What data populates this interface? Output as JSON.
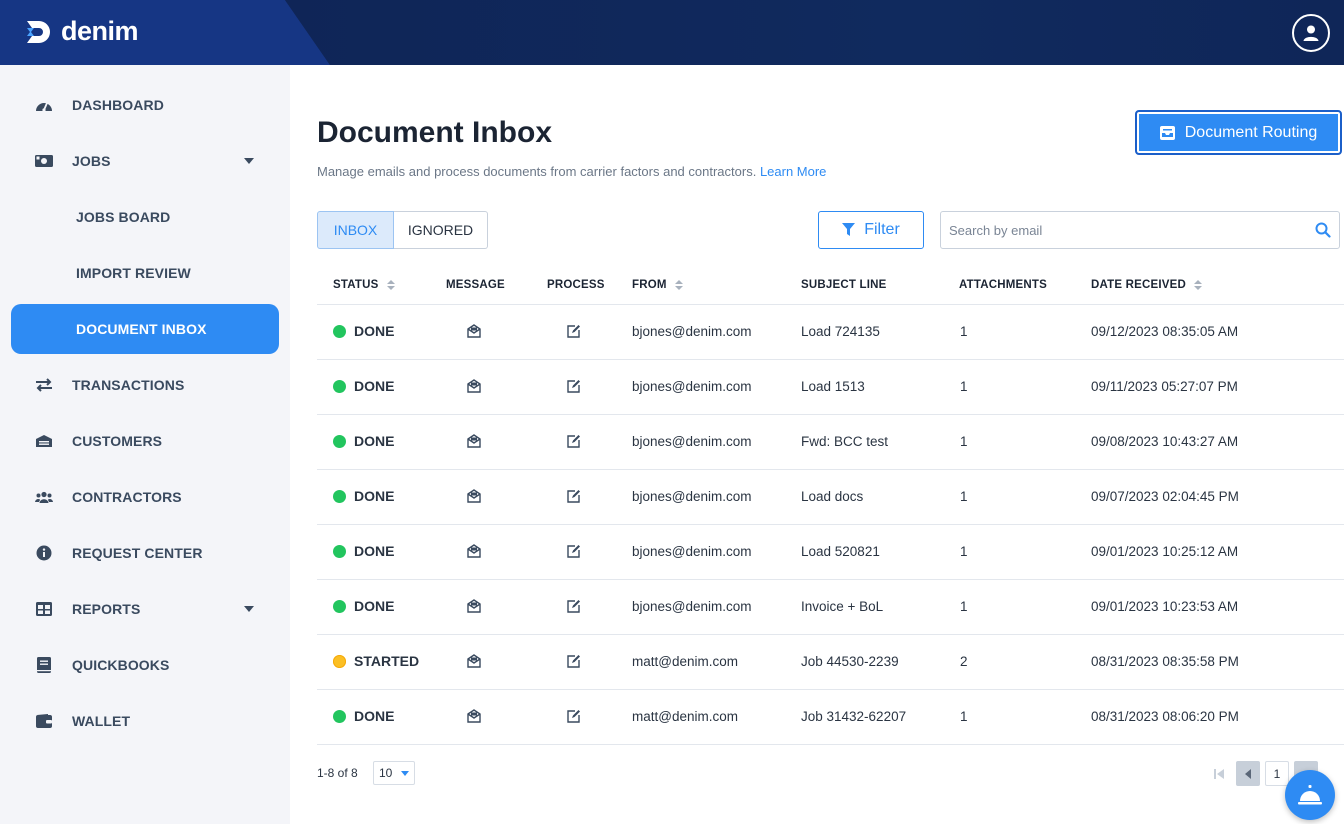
{
  "brand": {
    "name": "denim"
  },
  "sidebar": {
    "items": [
      {
        "label": "DASHBOARD",
        "icon": "dashboard-icon"
      },
      {
        "label": "JOBS",
        "icon": "jobs-icon",
        "expandable": true
      },
      {
        "label": "JOBS BOARD",
        "sub": true
      },
      {
        "label": "IMPORT REVIEW",
        "sub": true
      },
      {
        "label": "DOCUMENT INBOX",
        "sub": true,
        "active": true
      },
      {
        "label": "TRANSACTIONS",
        "icon": "transfer-icon"
      },
      {
        "label": "CUSTOMERS",
        "icon": "building-icon"
      },
      {
        "label": "CONTRACTORS",
        "icon": "users-icon"
      },
      {
        "label": "REQUEST CENTER",
        "icon": "info-icon"
      },
      {
        "label": "REPORTS",
        "icon": "table-icon",
        "expandable": true
      },
      {
        "label": "QUICKBOOKS",
        "icon": "book-icon"
      },
      {
        "label": "WALLET",
        "icon": "wallet-icon"
      }
    ]
  },
  "main": {
    "title": "Document Inbox",
    "subtitle": "Manage emails and process documents from carrier factors and contractors.",
    "learn_more": "Learn More",
    "routing_button": "Document Routing",
    "tabs": {
      "inbox": "INBOX",
      "ignored": "IGNORED"
    },
    "filter_label": "Filter",
    "search": {
      "placeholder": "Search by email",
      "value": ""
    }
  },
  "table": {
    "headers": {
      "status": "STATUS",
      "message": "MESSAGE",
      "process": "PROCESS",
      "from": "FROM",
      "subject": "SUBJECT LINE",
      "attachments": "ATTACHMENTS",
      "date": "DATE RECEIVED"
    },
    "rows": [
      {
        "status": "DONE",
        "from": "bjones@denim.com",
        "subject": "Load 724135",
        "attachments": "1",
        "date": "09/12/2023 08:35:05 AM"
      },
      {
        "status": "DONE",
        "from": "bjones@denim.com",
        "subject": "Load 1513",
        "attachments": "1",
        "date": "09/11/2023 05:27:07 PM"
      },
      {
        "status": "DONE",
        "from": "bjones@denim.com",
        "subject": "Fwd: BCC test",
        "attachments": "1",
        "date": "09/08/2023 10:43:27 AM"
      },
      {
        "status": "DONE",
        "from": "bjones@denim.com",
        "subject": "Load docs",
        "attachments": "1",
        "date": "09/07/2023 02:04:45 PM"
      },
      {
        "status": "DONE",
        "from": "bjones@denim.com",
        "subject": "Load 520821",
        "attachments": "1",
        "date": "09/01/2023 10:25:12 AM"
      },
      {
        "status": "DONE",
        "from": "bjones@denim.com",
        "subject": "Invoice + BoL",
        "attachments": "1",
        "date": "09/01/2023 10:23:53 AM"
      },
      {
        "status": "STARTED",
        "from": "matt@denim.com",
        "subject": "Job 44530-2239",
        "attachments": "2",
        "date": "08/31/2023 08:35:58 PM"
      },
      {
        "status": "DONE",
        "from": "matt@denim.com",
        "subject": "Job 31432-62207",
        "attachments": "1",
        "date": "08/31/2023 08:06:20 PM"
      }
    ]
  },
  "footer": {
    "range": "1-8 of 8",
    "per_page": "10",
    "current_page": "1"
  },
  "colors": {
    "accent": "#2e8bf3",
    "header": "#0d1f4d",
    "done": "#22c55e",
    "started": "#fbbf24"
  }
}
